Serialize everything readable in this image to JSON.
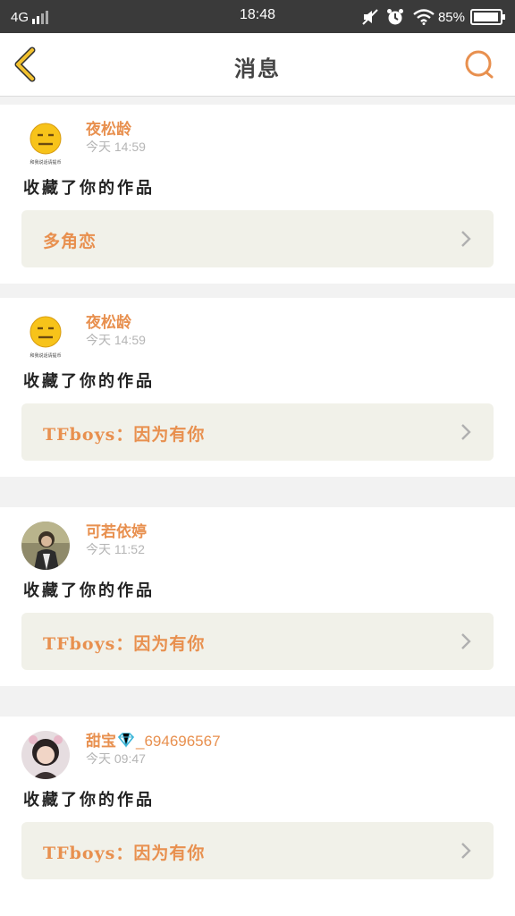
{
  "status_bar": {
    "network": "4G",
    "time": "18:48",
    "battery": "85%",
    "icons": [
      "signal-icon",
      "mute-icon",
      "alarm-icon",
      "wifi-icon",
      "battery-icon"
    ]
  },
  "header": {
    "title": "消息",
    "back_icon": "back-chevron-icon",
    "search_icon": "search-icon"
  },
  "colors": {
    "accent": "#e8904f",
    "back_icon": "#f2c12e",
    "status_bar": "#3a3a3a",
    "card_bg": "#ffffff",
    "work_bg": "#f1f1e9",
    "page_bg": "#f2f2f2"
  },
  "messages": [
    {
      "user": "夜松龄",
      "time": "今天 14:59",
      "action": "收藏了你的作品",
      "work": "多角恋",
      "avatar": "neutral-face-emoji",
      "avatar_caption": "和我说话请提币"
    },
    {
      "user": "夜松龄",
      "time": "今天 14:59",
      "action": "收藏了你的作品",
      "work": "TFboys：因为有你",
      "avatar": "neutral-face-emoji",
      "avatar_caption": "和我说话请提币"
    },
    {
      "user": "可若依婷",
      "time": "今天 11:52",
      "action": "收藏了你的作品",
      "work": "TFboys：因为有你",
      "avatar": "photo-avatar"
    },
    {
      "user": "甜宝",
      "user_suffix": "_694696567",
      "time": "今天 09:47",
      "action": "收藏了你的作品",
      "work": "TFboys：因为有你",
      "avatar": "photo-avatar-girl",
      "badge_icon": "diamond-badge-icon"
    }
  ]
}
